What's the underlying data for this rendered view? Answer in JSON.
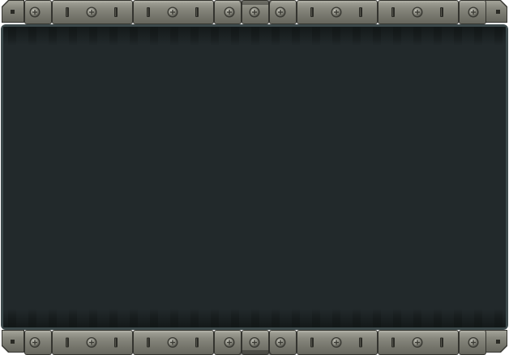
{
  "panel": {
    "style": "riveted-metal-frame",
    "screen_color": "#22292b",
    "screen_border_color": "#3d4a4c",
    "frame_color": "#77776d",
    "frame_dark": "#3c3c36",
    "frame_light": "#a2a298",
    "screen_content": ""
  },
  "top_rail": {
    "icons": [
      "rivet-icon",
      "slot-icon",
      "corner-bracket-icon"
    ]
  },
  "bottom_rail": {
    "icons": [
      "rivet-icon",
      "slot-icon",
      "corner-bracket-icon"
    ]
  }
}
